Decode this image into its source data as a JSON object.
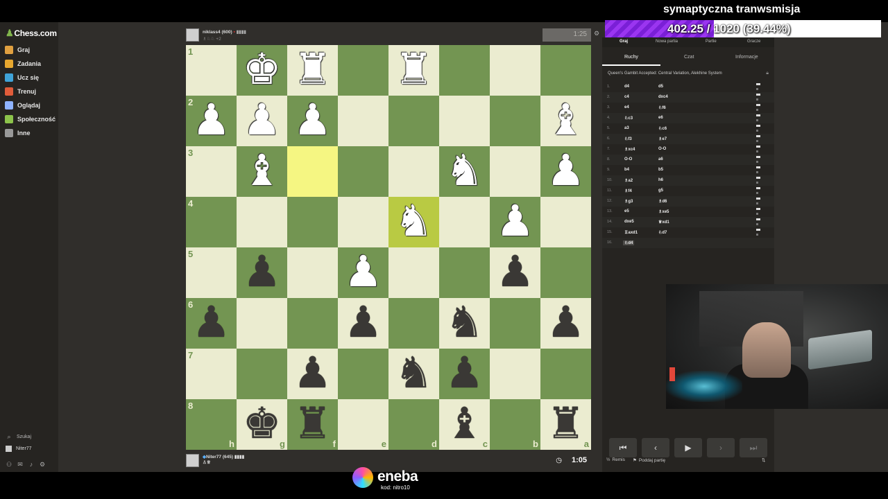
{
  "overlay": {
    "title": "symaptyczna tranwsmisja",
    "progress_text": "402.25 / 1020 (39.44%)",
    "progress_fraction": 0.3944
  },
  "sponsor": {
    "name": "eneba",
    "code": "kod: nitro10"
  },
  "sidebar": {
    "logo": "Chess.com",
    "items": [
      {
        "label": "Graj",
        "icon": "play-icon",
        "color": "#e0a040"
      },
      {
        "label": "Zadania",
        "icon": "puzzle-icon",
        "color": "#e7a72f"
      },
      {
        "label": "Ucz się",
        "icon": "learn-icon",
        "color": "#3fa3d8"
      },
      {
        "label": "Trenuj",
        "icon": "train-icon",
        "color": "#e05c3a"
      },
      {
        "label": "Oglądaj",
        "icon": "watch-icon",
        "color": "#8fb3ff"
      },
      {
        "label": "Społeczność",
        "icon": "community-icon",
        "color": "#8cc34b"
      },
      {
        "label": "Inne",
        "icon": "more-icon",
        "color": "#999999"
      }
    ],
    "search": "Szukaj",
    "user": "Niter77"
  },
  "game": {
    "top_player": {
      "name": "niklass4 (600)",
      "extra": "+2",
      "clock": "1:25"
    },
    "bottom_player": {
      "name": "Niter77 (645)",
      "clock": "1:05"
    },
    "board": {
      "ranks": [
        "1",
        "2",
        "3",
        "4",
        "5",
        "6",
        "7",
        "8"
      ],
      "files": [
        "h",
        "g",
        "f",
        "e",
        "d",
        "c",
        "b",
        "a"
      ],
      "squares": [
        [
          "",
          "wK",
          "wR",
          "",
          "wR",
          "",
          "",
          ""
        ],
        [
          "wP",
          "wP",
          "wP",
          "",
          "",
          "",
          "",
          "wB"
        ],
        [
          "",
          "wB",
          "",
          "",
          "",
          "wN",
          "",
          "wP"
        ],
        [
          "",
          "",
          "",
          "",
          "wN",
          "",
          "wP",
          ""
        ],
        [
          "",
          "bP",
          "",
          "wP",
          "",
          "",
          "bP",
          ""
        ],
        [
          "bP",
          "",
          "",
          "bP",
          "",
          "bN",
          "",
          "bP"
        ],
        [
          "",
          "",
          "bP",
          "",
          "bN",
          "bP",
          "",
          ""
        ],
        [
          "",
          "bK",
          "bR",
          "",
          "",
          "bB",
          "",
          "bR"
        ]
      ],
      "highlights": [
        "2,2",
        "3,4"
      ]
    }
  },
  "panel": {
    "top_tabs": [
      "Graj",
      "Nowa partia",
      "Partie",
      "Gracze"
    ],
    "sub_tabs": [
      "Ruchy",
      "Czat",
      "Informacje"
    ],
    "opening": "Queen's Gambit Accepted: Central Variation, Alekhine System",
    "moves": [
      {
        "n": "1.",
        "w": "d4",
        "b": "d5"
      },
      {
        "n": "2.",
        "w": "c4",
        "b": "dxc4"
      },
      {
        "n": "3.",
        "w": "e4",
        "b": "♘f6"
      },
      {
        "n": "4.",
        "w": "♘c3",
        "b": "e6"
      },
      {
        "n": "5.",
        "w": "a3",
        "b": "♘c6"
      },
      {
        "n": "6.",
        "w": "♘f3",
        "b": "♗e7"
      },
      {
        "n": "7.",
        "w": "♗xc4",
        "b": "O-O"
      },
      {
        "n": "8.",
        "w": "O-O",
        "b": "a6"
      },
      {
        "n": "9.",
        "w": "b4",
        "b": "b5"
      },
      {
        "n": "10.",
        "w": "♗a2",
        "b": "h6"
      },
      {
        "n": "11.",
        "w": "♗f4",
        "b": "g5"
      },
      {
        "n": "12.",
        "w": "♗g3",
        "b": "♗d6"
      },
      {
        "n": "13.",
        "w": "e5",
        "b": "♗xe5"
      },
      {
        "n": "14.",
        "w": "dxe5",
        "b": "♕xd1"
      },
      {
        "n": "15.",
        "w": "♖axd1",
        "b": "♘d7"
      },
      {
        "n": "16.",
        "w": "♘d4",
        "b": ""
      }
    ],
    "controls": [
      "first-icon",
      "prev-icon",
      "play-icon",
      "next-icon",
      "last-icon"
    ],
    "draw_label": "Remis",
    "resign_label": "Poddaj partię"
  }
}
